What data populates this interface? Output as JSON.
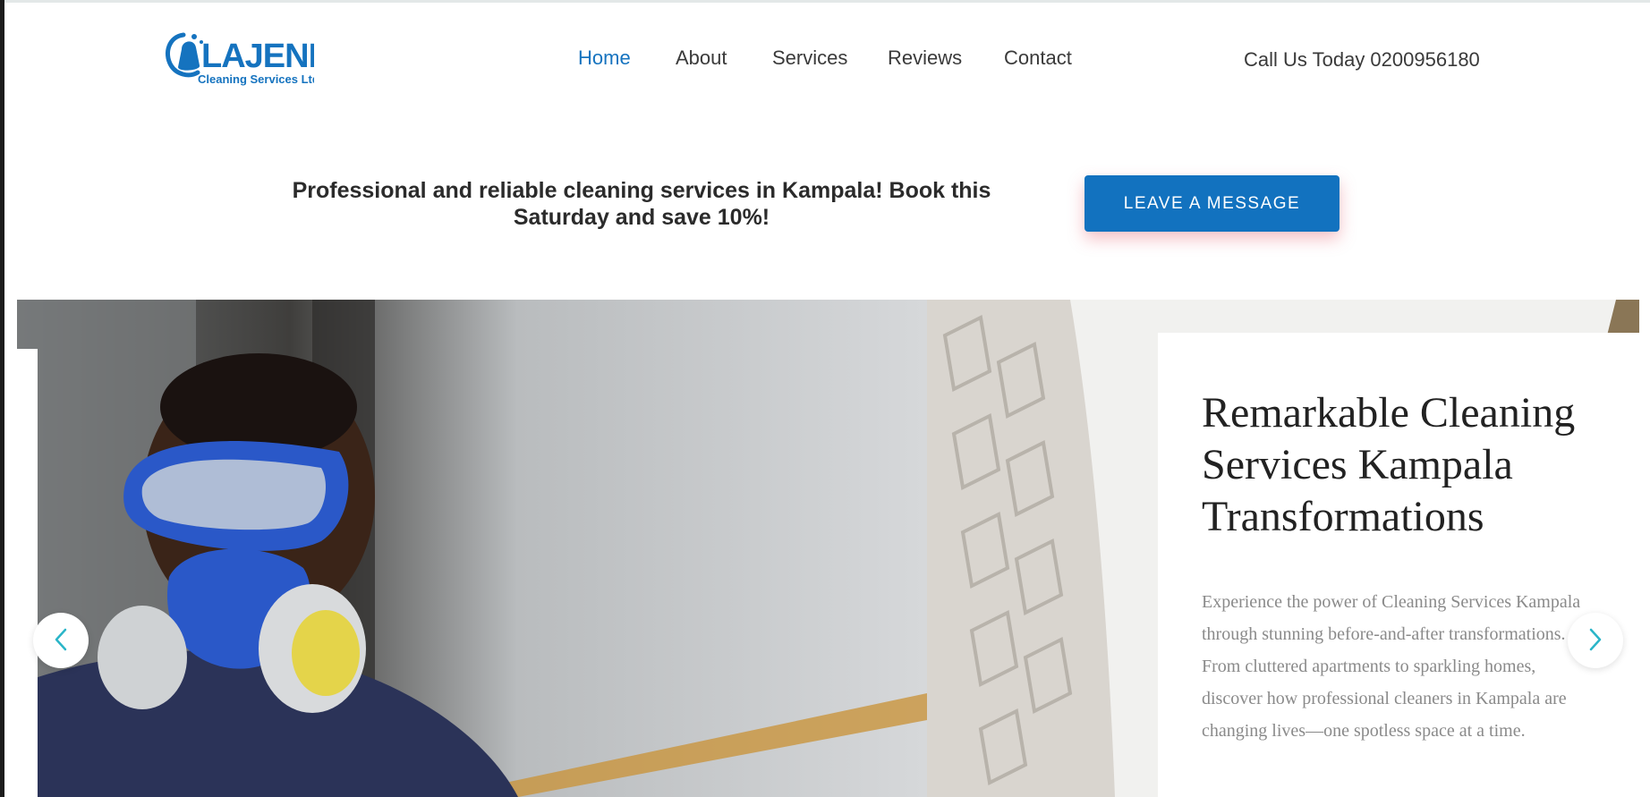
{
  "brand": {
    "name": "LAJENI",
    "tagline": "Cleaning Services Ltd",
    "color": "#1573bf"
  },
  "nav": {
    "items": [
      {
        "label": "Home",
        "active": true
      },
      {
        "label": "About",
        "active": false
      },
      {
        "label": "Services",
        "active": false
      },
      {
        "label": "Reviews",
        "active": false
      },
      {
        "label": "Contact",
        "active": false
      }
    ]
  },
  "header": {
    "call_text": "Call Us Today 0200956180"
  },
  "promo": {
    "text": "Professional and reliable cleaning services in Kampala! Book this Saturday and save 10%!",
    "button_label": "LEAVE A MESSAGE"
  },
  "hero": {
    "title": "Remarkable Cleaning Services Kampala Transformations",
    "description": "Experience the power of Cleaning Services Kampala through stunning before-and-after transformations. From cluttered apartments to sparkling homes, discover how professional cleaners in Kampala are changing lives—one spotless space at a time.",
    "prev_icon": "chevron-left-icon",
    "next_icon": "chevron-right-icon",
    "accent": "#2ab5c8"
  }
}
